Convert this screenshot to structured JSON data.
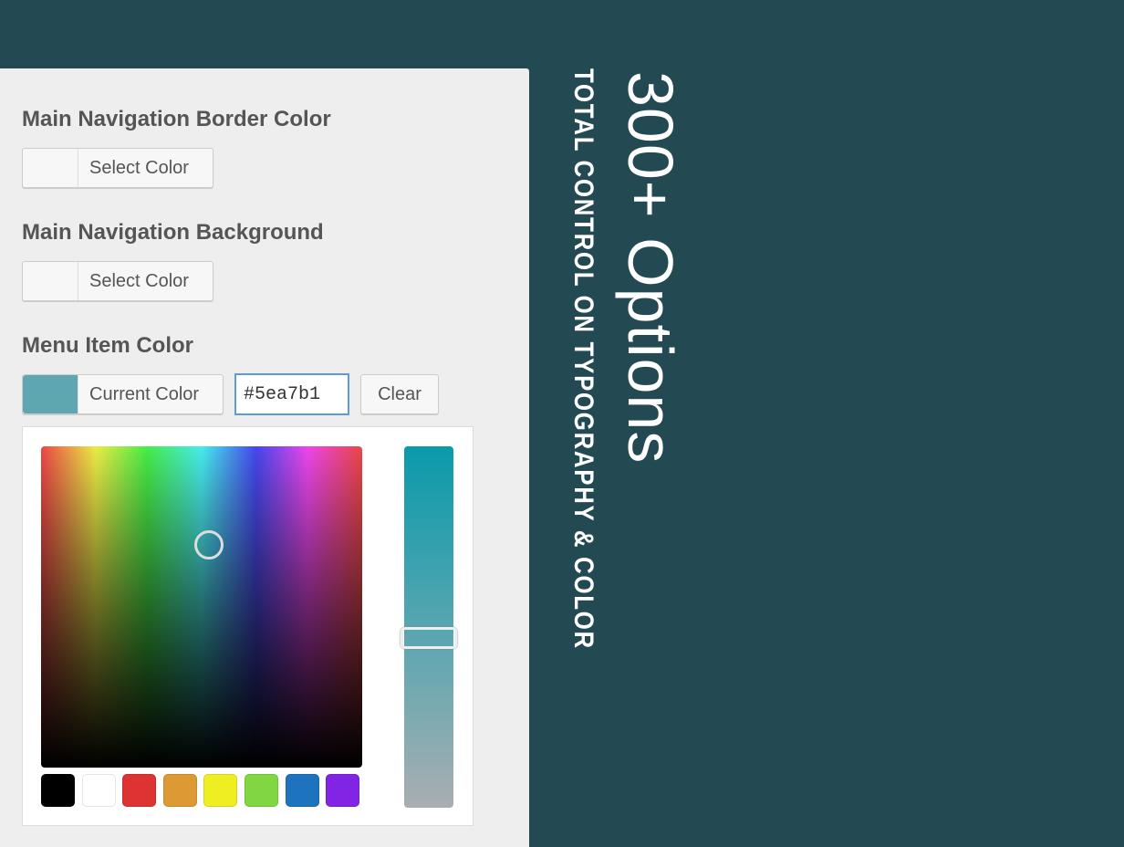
{
  "fields": [
    {
      "label": "Main Navigation Border Color",
      "button": "Select Color",
      "color": "#f7f7f7"
    },
    {
      "label": "Main Navigation Background",
      "button": "Select Color",
      "color": "#f7f7f7"
    },
    {
      "label": "Menu Item Color",
      "button": "Current Color",
      "color": "#5ea7b1",
      "hex_value": "#5ea7b1",
      "clear": "Clear"
    }
  ],
  "palette": [
    {
      "name": "black",
      "color": "#000000"
    },
    {
      "name": "white",
      "color": "#ffffff"
    },
    {
      "name": "red",
      "color": "#dd3333"
    },
    {
      "name": "orange",
      "color": "#dd9933"
    },
    {
      "name": "yellow",
      "color": "#eeee22"
    },
    {
      "name": "green",
      "color": "#81d742"
    },
    {
      "name": "blue",
      "color": "#1e73be"
    },
    {
      "name": "purple",
      "color": "#8224e3"
    }
  ],
  "promo": {
    "headline": "300+ Options",
    "subline": "TOTAL CONTROL ON TYPOGRAPHY & COLOR"
  },
  "colors": {
    "background": "#234a53",
    "panel": "#eeeeee"
  }
}
